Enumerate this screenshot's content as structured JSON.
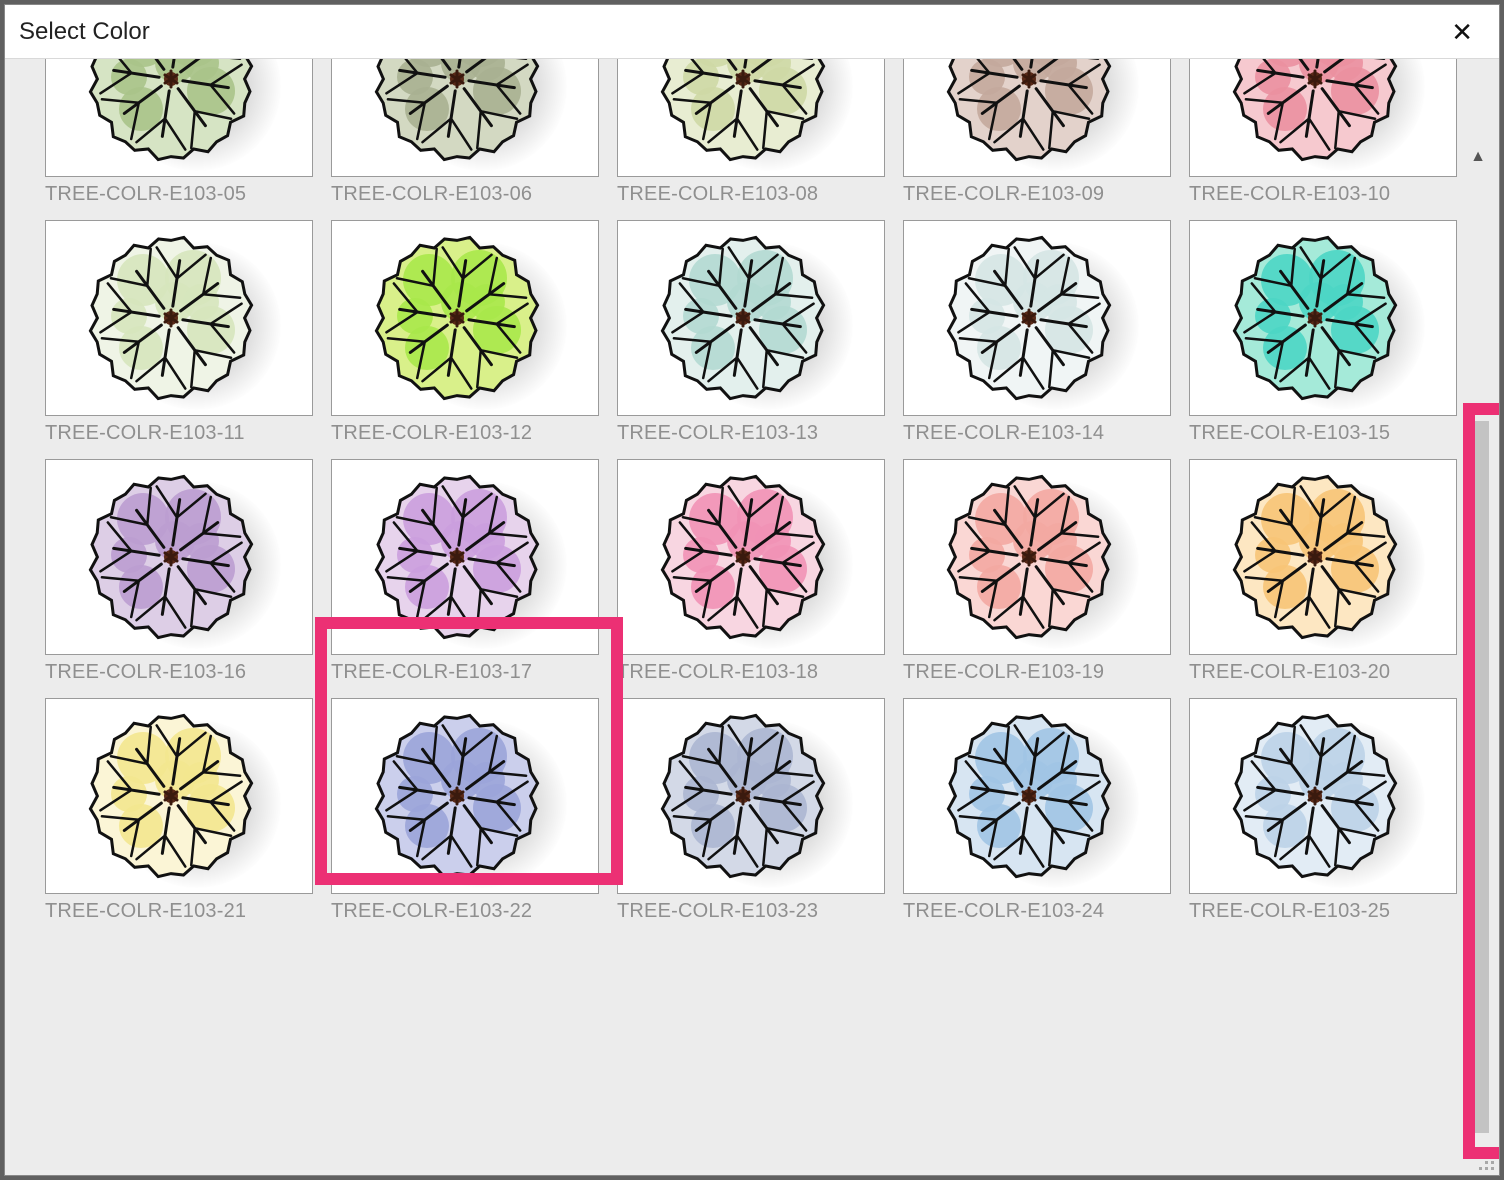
{
  "dialog": {
    "title": "Select Color"
  },
  "items": [
    {
      "label": "TREE-COLR-E103-05",
      "fillLight": "#d6e4c4",
      "fillDark": "#aac38a"
    },
    {
      "label": "TREE-COLR-E103-06",
      "fillLight": "#d3d9c2",
      "fillDark": "#a8b091"
    },
    {
      "label": "TREE-COLR-E103-08",
      "fillLight": "#e8edd2",
      "fillDark": "#ced8a5"
    },
    {
      "label": "TREE-COLR-E103-09",
      "fillLight": "#e3d2cb",
      "fillDark": "#c3a89c"
    },
    {
      "label": "TREE-COLR-E103-10",
      "fillLight": "#f6c9cf",
      "fillDark": "#eb90a0"
    },
    {
      "label": "TREE-COLR-E103-11",
      "fillLight": "#eff4e6",
      "fillDark": "#d6e5bd"
    },
    {
      "label": "TREE-COLR-E103-12",
      "fillLight": "#d9f08a",
      "fillDark": "#a9e84a"
    },
    {
      "label": "TREE-COLR-E103-13",
      "fillLight": "#e3f0ed",
      "fillDark": "#b3d9d1"
    },
    {
      "label": "TREE-COLR-E103-14",
      "fillLight": "#f0f5f5",
      "fillDark": "#d5e6e4"
    },
    {
      "label": "TREE-COLR-E103-15",
      "fillLight": "#a5ead9",
      "fillDark": "#4dd6c4"
    },
    {
      "label": "TREE-COLR-E103-16",
      "fillLight": "#ddcee6",
      "fillDark": "#bb9dd0"
    },
    {
      "label": "TREE-COLR-E103-17",
      "fillLight": "#e7d3ec",
      "fillDark": "#cb9ede"
    },
    {
      "label": "TREE-COLR-E103-18",
      "fillLight": "#f8d6e1",
      "fillDark": "#f192b6"
    },
    {
      "label": "TREE-COLR-E103-19",
      "fillLight": "#fad7d4",
      "fillDark": "#f3a8a2"
    },
    {
      "label": "TREE-COLR-E103-20",
      "fillLight": "#fde7c2",
      "fillDark": "#f7c477"
    },
    {
      "label": "TREE-COLR-E103-21",
      "fillLight": "#fbf5d6",
      "fillDark": "#f3e78f"
    },
    {
      "label": "TREE-COLR-E103-22",
      "fillLight": "#cbcfec",
      "fillDark": "#9ba4d9"
    },
    {
      "label": "TREE-COLR-E103-23",
      "fillLight": "#d3d9e7",
      "fillDark": "#acb6d2"
    },
    {
      "label": "TREE-COLR-E103-24",
      "fillLight": "#d7e5f2",
      "fillDark": "#a1c4e4"
    },
    {
      "label": "TREE-COLR-E103-25",
      "fillLight": "#e2ecf5",
      "fillDark": "#bdd3e8"
    }
  ],
  "highlights": {
    "selected_index": 11
  }
}
